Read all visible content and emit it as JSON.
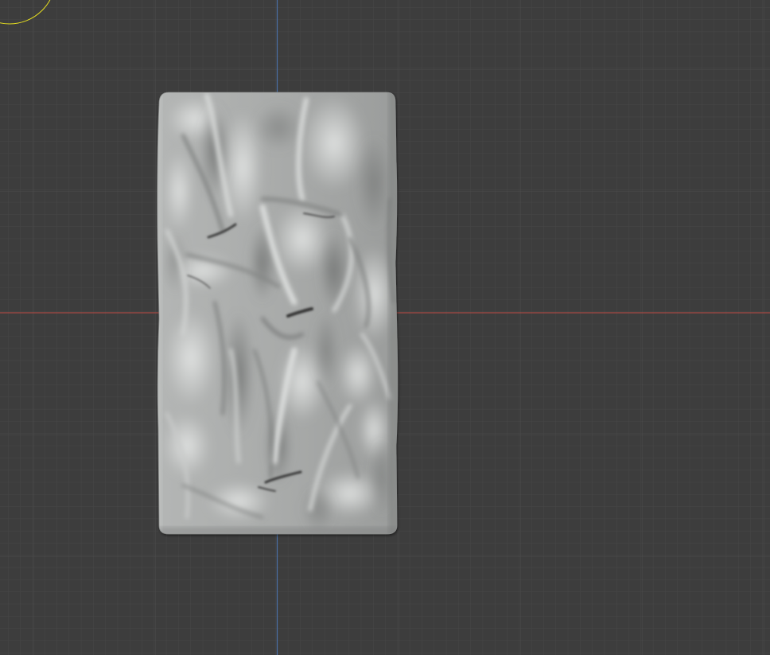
{
  "viewport": {
    "background_color": "#3d3d3d",
    "grid_minor_color": "#474747",
    "grid_major_color": "#4c4c4c",
    "x_axis_color": "#a44a44",
    "y_axis_color": "#4a6fa6",
    "light_gizmo_color": "#e8e020"
  },
  "object": {
    "type": "cloth-plane",
    "shading": "solid",
    "base_color": "#a6a8a7",
    "highlight_color": "#dadcdb",
    "shadow_color": "#6b6d6c",
    "crease_color": "#303030"
  },
  "gizmos": [
    {
      "name": "light-gizmo",
      "shape": "circle-outline"
    }
  ]
}
